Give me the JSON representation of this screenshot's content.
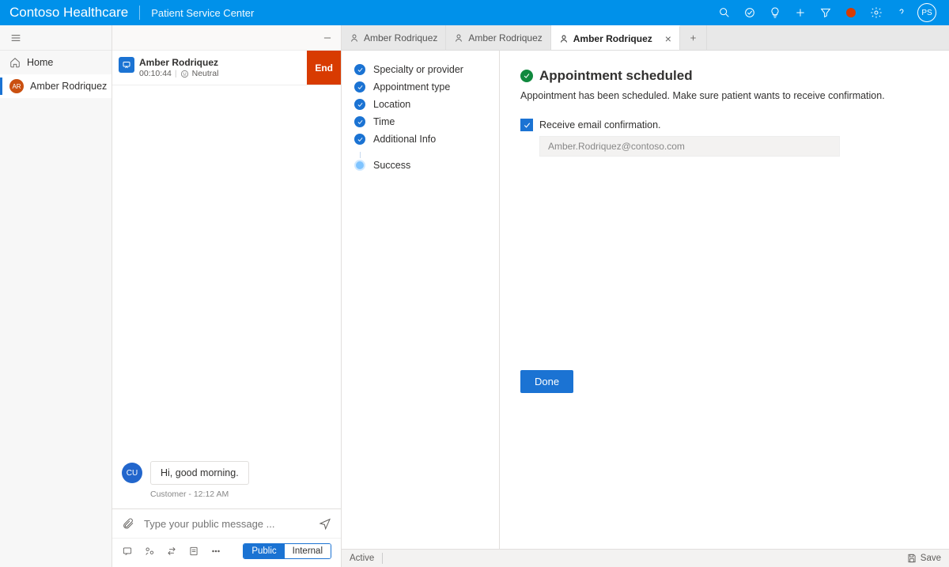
{
  "header": {
    "brand": "Contoso Healthcare",
    "subtitle": "Patient Service Center",
    "user_initials": "PS"
  },
  "nav": {
    "home_label": "Home",
    "session": {
      "initials": "AR",
      "label": "Amber Rodriquez"
    }
  },
  "conversation": {
    "name": "Amber Rodriquez",
    "timer": "00:10:44",
    "sentiment_label": "Neutral",
    "end_label": "End",
    "message_avatar": "CU",
    "message_text": "Hi, good morning.",
    "message_meta": "Customer - 12:12 AM",
    "compose_placeholder": "Type your public message ...",
    "visibility": {
      "public": "Public",
      "internal": "Internal"
    }
  },
  "tabs": {
    "items": [
      "Amber Rodriquez",
      "Amber Rodriquez",
      "Amber Rodriquez"
    ],
    "active_index": 2
  },
  "steps": [
    "Specialty or provider",
    "Appointment type",
    "Location",
    "Time",
    "Additional Info",
    "Success"
  ],
  "success": {
    "title": "Appointment scheduled",
    "subtitle": "Appointment has been scheduled. Make sure patient wants to receive confirmation.",
    "checkbox_label": "Receive email confirmation.",
    "email_value": "Amber.Rodriquez@contoso.com",
    "done_label": "Done"
  },
  "status": {
    "state": "Active",
    "save_label": "Save"
  }
}
